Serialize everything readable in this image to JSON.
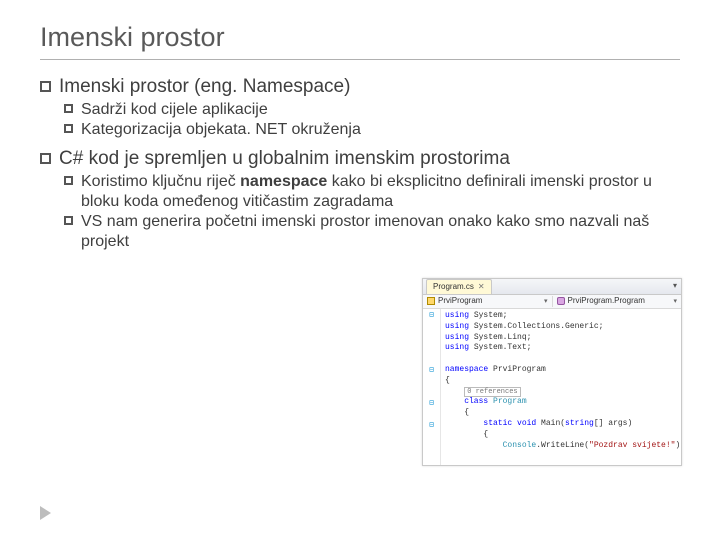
{
  "title": "Imenski prostor",
  "b1a": "Imenski prostor (eng. Namespace)",
  "b2a": "Sadrži kod cijele aplikacije",
  "b2b": "Kategorizacija objekata. NET okruženja",
  "b1b": "C# kod je spremljen u globalnim imenskim prostorima",
  "b2c_pre": "Koristimo ključnu riječ ",
  "b2c_kw": "namespace",
  "b2c_post": " kako bi eksplicitno definirali imenski prostor u bloku koda omeđenog vitičastim zagradama",
  "b2d": "VS nam generira početni imenski prostor imenovan onako kako smo nazvali naš projekt",
  "code": {
    "tab": "Program.cs",
    "nav_left": "PrviProgram",
    "nav_right": "PrviProgram.Program",
    "lines": {
      "u1": "using",
      "u1t": " System;",
      "u2": "using",
      "u2t": " System.Collections.Generic;",
      "u3": "using",
      "u3t": " System.Linq;",
      "u4": "using",
      "u4t": " System.Text;",
      "ns": "namespace",
      "nst": " PrviProgram",
      "ref": "0 references",
      "cl": "class",
      "clt": " Program",
      "st": "static",
      "vd": " void",
      "mn": " Main(",
      "str": "string",
      "mn2": "[] args)",
      "cw": "Console",
      "cwm": ".WriteLine(",
      "s": "\"Pozdrav svijete!\"",
      "cend": ");"
    }
  }
}
